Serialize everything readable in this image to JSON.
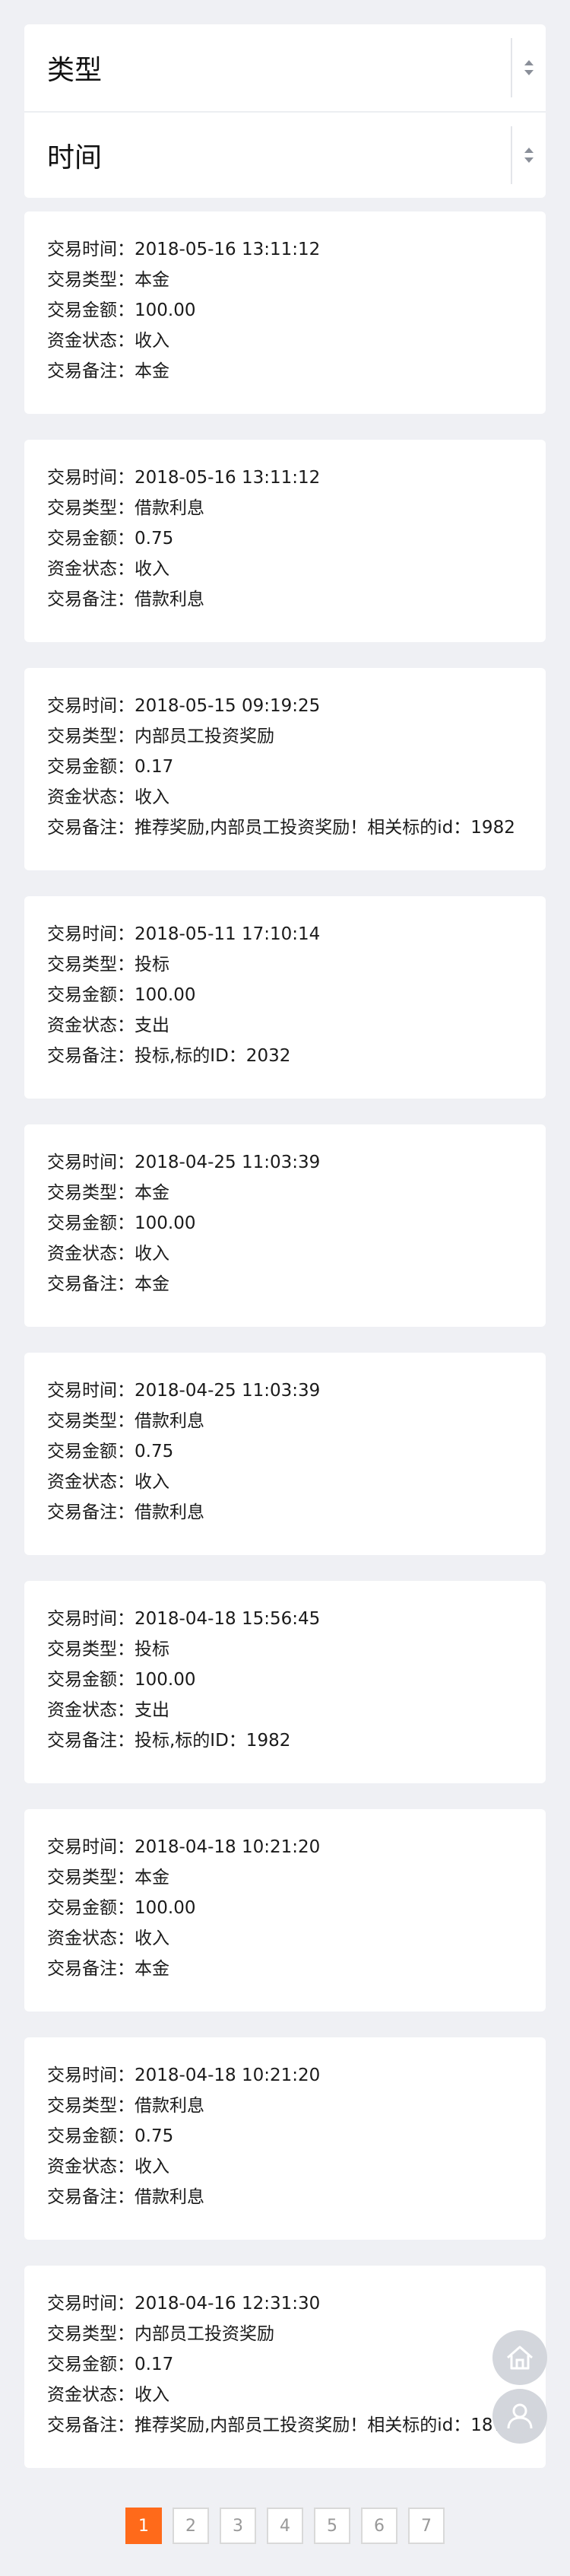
{
  "filters": {
    "type_label": "类型",
    "time_label": "时间"
  },
  "field_labels": {
    "time": "交易时间：",
    "type": "交易类型：",
    "amount": "交易金额：",
    "status": "资金状态：",
    "note": "交易备注："
  },
  "records": [
    {
      "time": "2018-05-16 13:11:12",
      "type": "本金",
      "amount": "100.00",
      "status": "收入",
      "note": "本金"
    },
    {
      "time": "2018-05-16 13:11:12",
      "type": "借款利息",
      "amount": "0.75",
      "status": "收入",
      "note": "借款利息"
    },
    {
      "time": "2018-05-15 09:19:25",
      "type": "内部员工投资奖励",
      "amount": "0.17",
      "status": "收入",
      "note": "推荐奖励,内部员工投资奖励！相关标的id：1982"
    },
    {
      "time": "2018-05-11 17:10:14",
      "type": "投标",
      "amount": "100.00",
      "status": "支出",
      "note": "投标,标的ID：2032"
    },
    {
      "time": "2018-04-25 11:03:39",
      "type": "本金",
      "amount": "100.00",
      "status": "收入",
      "note": "本金"
    },
    {
      "time": "2018-04-25 11:03:39",
      "type": "借款利息",
      "amount": "0.75",
      "status": "收入",
      "note": "借款利息"
    },
    {
      "time": "2018-04-18 15:56:45",
      "type": "投标",
      "amount": "100.00",
      "status": "支出",
      "note": "投标,标的ID：1982"
    },
    {
      "time": "2018-04-18 10:21:20",
      "type": "本金",
      "amount": "100.00",
      "status": "收入",
      "note": "本金"
    },
    {
      "time": "2018-04-18 10:21:20",
      "type": "借款利息",
      "amount": "0.75",
      "status": "收入",
      "note": "借款利息"
    },
    {
      "time": "2018-04-16 12:31:30",
      "type": "内部员工投资奖励",
      "amount": "0.17",
      "status": "收入",
      "note": "推荐奖励,内部员工投资奖励！相关标的id：1874"
    }
  ],
  "pagination": {
    "pages": [
      "1",
      "2",
      "3",
      "4",
      "5",
      "6",
      "7"
    ],
    "current": "1"
  },
  "icons": {
    "home": "home-icon",
    "user": "user-icon"
  },
  "colors": {
    "accent": "#ff6a1a",
    "background": "#eff0f4"
  }
}
